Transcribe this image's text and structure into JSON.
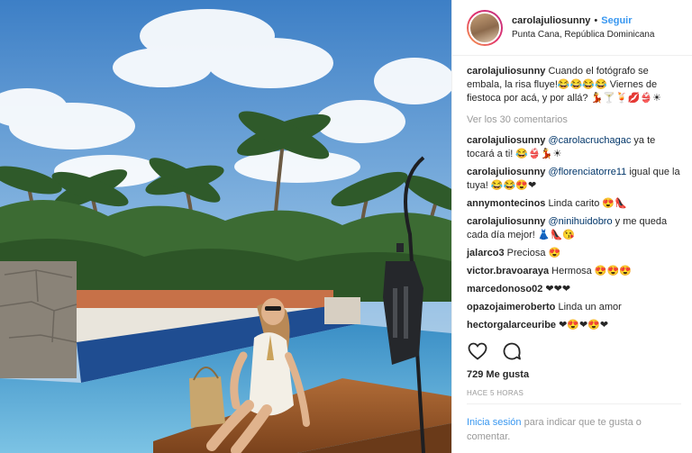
{
  "post": {
    "username": "carolajuliosunny",
    "separator": "•",
    "follow_label": "Seguir",
    "location": "Punta Cana, República Dominicana"
  },
  "caption": {
    "username": "carolajuliosunny",
    "text": "Cuando el fotógrafo se embala, la risa fluye!😂😂😂😂 Viernes de fiestoca por acá, y por allá? 💃🍸🍹💋👙☀"
  },
  "view_all_label": "Ver los 30 comentarios",
  "comments": [
    {
      "username": "carolajuliosunny",
      "mention": "@carolacruchagac",
      "text": " ya te tocará a ti! 😂👙💃☀"
    },
    {
      "username": "carolajuliosunny",
      "mention": "@florenciatorre11",
      "text": " igual que la tuya! 😂😂😍❤"
    },
    {
      "username": "annymontecinos",
      "mention": "",
      "text": " Linda carito 😍👠"
    },
    {
      "username": "carolajuliosunny",
      "mention": "@ninihuidobro",
      "text": " y me queda cada día mejor! 👗👠😘"
    },
    {
      "username": "jalarco3",
      "mention": "",
      "text": " Preciosa 😍"
    },
    {
      "username": "victor.bravoaraya",
      "mention": "",
      "text": " Hermosa 😍😍😍"
    },
    {
      "username": "marcedonoso02",
      "mention": "",
      "text": " ❤❤❤"
    },
    {
      "username": "opazojaimeroberto",
      "mention": "",
      "text": " Linda un amor"
    },
    {
      "username": "hectorgalarceuribe",
      "mention": "",
      "text": " ❤😍❤😍❤"
    }
  ],
  "icons": {
    "like": "heart-outline-icon",
    "comment": "comment-bubble-icon"
  },
  "likes_label": "729 Me gusta",
  "time_label": "HACE 5 HORAS",
  "login": {
    "link": "Inicia sesión",
    "text": " para indicar que te gusta o comentar."
  },
  "colors": {
    "link": "#3897f0",
    "mention": "#003569",
    "muted": "#999999",
    "text": "#262626"
  }
}
